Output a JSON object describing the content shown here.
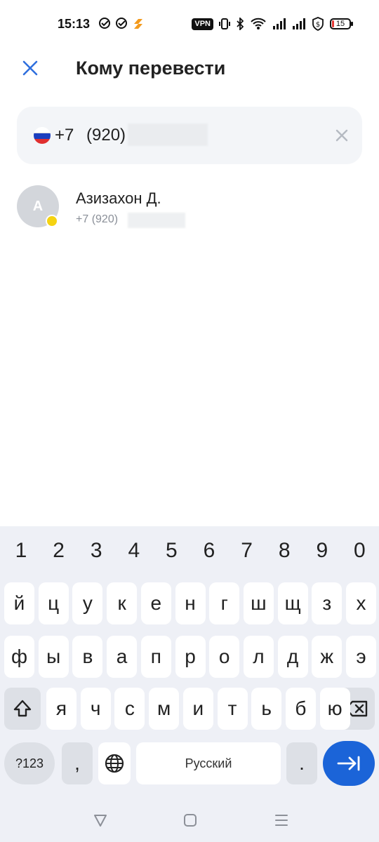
{
  "status_bar": {
    "time": "15:13",
    "vpn_label": "VPN",
    "battery_level": "15",
    "left_icons": [
      "check-circle-icon",
      "check-circle-icon",
      "app-notification-icon"
    ],
    "right_icons": [
      "vpn-icon",
      "vibrate-icon",
      "bluetooth-icon",
      "wifi-icon",
      "signal-icon",
      "signal-icon",
      "shield-dollar-icon",
      "battery-icon"
    ]
  },
  "header": {
    "title": "Кому перевести",
    "close_icon": "close-icon"
  },
  "phone_input": {
    "country_code": "+7",
    "value": "(920)",
    "flag": "russia-flag-icon",
    "clear_icon": "clear-icon"
  },
  "contacts": [
    {
      "initial": "А",
      "name": "Азизахон Д.",
      "phone": "+7 (920)",
      "status_color": "#f5d312"
    }
  ],
  "keyboard": {
    "numbers": [
      "1",
      "2",
      "3",
      "4",
      "5",
      "6",
      "7",
      "8",
      "9",
      "0"
    ],
    "row1": [
      "й",
      "ц",
      "у",
      "к",
      "е",
      "н",
      "г",
      "ш",
      "щ",
      "з",
      "х"
    ],
    "row2": [
      "ф",
      "ы",
      "в",
      "а",
      "п",
      "р",
      "о",
      "л",
      "д",
      "ж",
      "э"
    ],
    "row3": [
      "я",
      "ч",
      "с",
      "м",
      "и",
      "т",
      "ь",
      "б",
      "ю"
    ],
    "symbols_label": "?123",
    "comma_label": ",",
    "space_label": "Русский",
    "period_label": ".",
    "accent_color": "#1b64d8"
  },
  "nav_bar": {
    "icons": [
      "back-triangle-icon",
      "home-square-icon",
      "recents-menu-icon"
    ]
  }
}
